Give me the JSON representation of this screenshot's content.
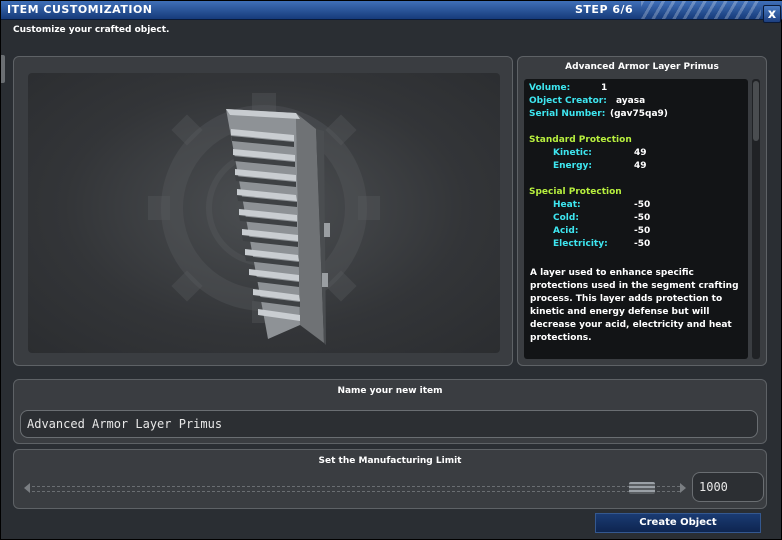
{
  "window": {
    "title": "ITEM CUSTOMIZATION",
    "step": "STEP 6/6",
    "close_label": "x",
    "subtitle": "Customize your crafted object."
  },
  "info": {
    "item_name": "Advanced Armor Layer Primus",
    "volume_label": "Volume:",
    "volume_value": "1",
    "creator_label": "Object Creator:",
    "creator_value": "ayasa",
    "serial_label": "Serial Number:",
    "serial_value": "(gav75qa9)",
    "standard_header": "Standard Protection",
    "standard": [
      {
        "label": "Kinetic:",
        "value": "49"
      },
      {
        "label": "Energy:",
        "value": "49"
      }
    ],
    "special_header": "Special Protection",
    "special": [
      {
        "label": "Heat:",
        "value": "-50"
      },
      {
        "label": "Cold:",
        "value": "-50"
      },
      {
        "label": "Acid:",
        "value": "-50"
      },
      {
        "label": "Electricity:",
        "value": "-50"
      }
    ],
    "description": "A layer used to enhance specific protections used in the segment crafting process.  This layer adds protection to kinetic and energy defense but will decrease your acid, electricity and heat protections."
  },
  "name_section": {
    "label": "Name your new item",
    "value": "Advanced Armor Layer Primus"
  },
  "limit_section": {
    "label": "Set the Manufacturing Limit",
    "value": "1000",
    "slider_fraction": 0.96
  },
  "actions": {
    "create_label": "Create Object"
  },
  "colors": {
    "title_bar": "#1e4a8c",
    "cyan_label": "#3ee6f0",
    "green_header": "#b8f03e",
    "button": "#0e2550"
  }
}
